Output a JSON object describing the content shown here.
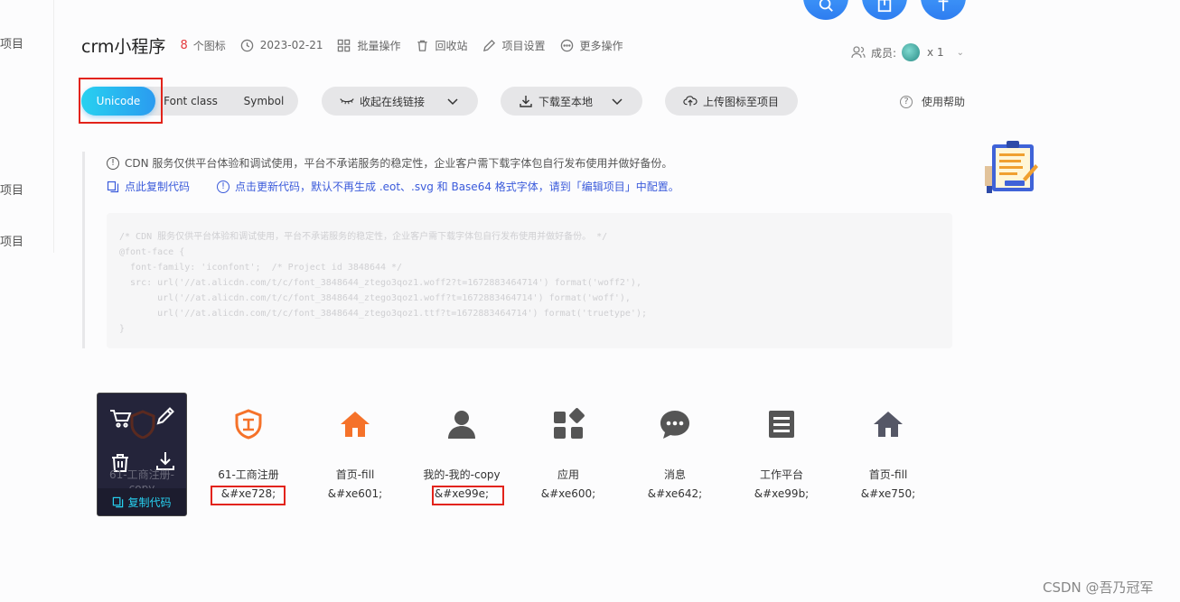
{
  "sidebar": {
    "items": [
      "项目",
      "项目",
      "项目"
    ]
  },
  "header": {
    "title": "crm小程序",
    "icon_count": "8",
    "icon_count_suffix": "个图标",
    "date": "2023-02-21",
    "batch": "批量操作",
    "recycle": "回收站",
    "settings": "项目设置",
    "more": "更多操作",
    "members_label": "成员:",
    "members_count": "x 1"
  },
  "tabs": {
    "unicode": "Unicode",
    "fontclass": "Font class",
    "symbol": "Symbol"
  },
  "toolbar": {
    "collapse_link": "收起在线链接",
    "download": "下载至本地",
    "upload": "上传图标至项目",
    "help": "使用帮助"
  },
  "notice": {
    "cdn_text": "CDN 服务仅供平台体验和调试使用，平台不承诺服务的稳定性，企业客户需下载字体包自行发布使用并做好备份。",
    "copy_code": "点此复制代码",
    "update_code": "点击更新代码，默认不再生成 .eot、.svg 和 Base64 格式字体，请到「编辑项目」中配置。"
  },
  "code_lines": [
    "/* CDN 服务仅供平台体验和调试使用，平台不承诺服务的稳定性，企业客户需下载字体包自行发布使用并做好备份。 */",
    "@font-face {",
    "  font-family: 'iconfont';  /* Project id 3848644 */",
    "  src: url('//at.alicdn.com/t/c/font_3848644_ztego3qoz1.woff2?t=1672883464714') format('woff2'),",
    "       url('//at.alicdn.com/t/c/font_3848644_ztego3qoz1.woff?t=1672883464714') format('woff'),",
    "       url('//at.alicdn.com/t/c/font_3848644_ztego3qoz1.ttf?t=1672883464714') format('truetype');",
    "}"
  ],
  "icons": [
    {
      "name": "61-工商注册",
      "code": "&#xe728;",
      "icon": "shield-icon",
      "color": "#f5722a"
    },
    {
      "name": "首页-fill",
      "code": "&#xe601;",
      "icon": "home-icon",
      "color": "#f5722a"
    },
    {
      "name": "我的-我的-copy",
      "code": "&#xe99e;",
      "icon": "user-icon",
      "color": "#555555"
    },
    {
      "name": "应用",
      "code": "&#xe600;",
      "icon": "apps-icon",
      "color": "#555555"
    },
    {
      "name": "消息",
      "code": "&#xe642;",
      "icon": "message-icon",
      "color": "#555555"
    },
    {
      "name": "工作平台",
      "code": "&#xe99b;",
      "icon": "document-icon",
      "color": "#555555"
    },
    {
      "name": "首页-fill",
      "code": "&#xe750;",
      "icon": "home-icon",
      "color": "#555766"
    }
  ],
  "hover_card": {
    "under_name": "61-工商注册-copy",
    "copy_label": "复制代码"
  },
  "watermark": "CSDN @吾乃冠军",
  "colors": {
    "accent": "#27d1f0",
    "highlight_box": "#e2231a",
    "count": "#e4393c"
  }
}
